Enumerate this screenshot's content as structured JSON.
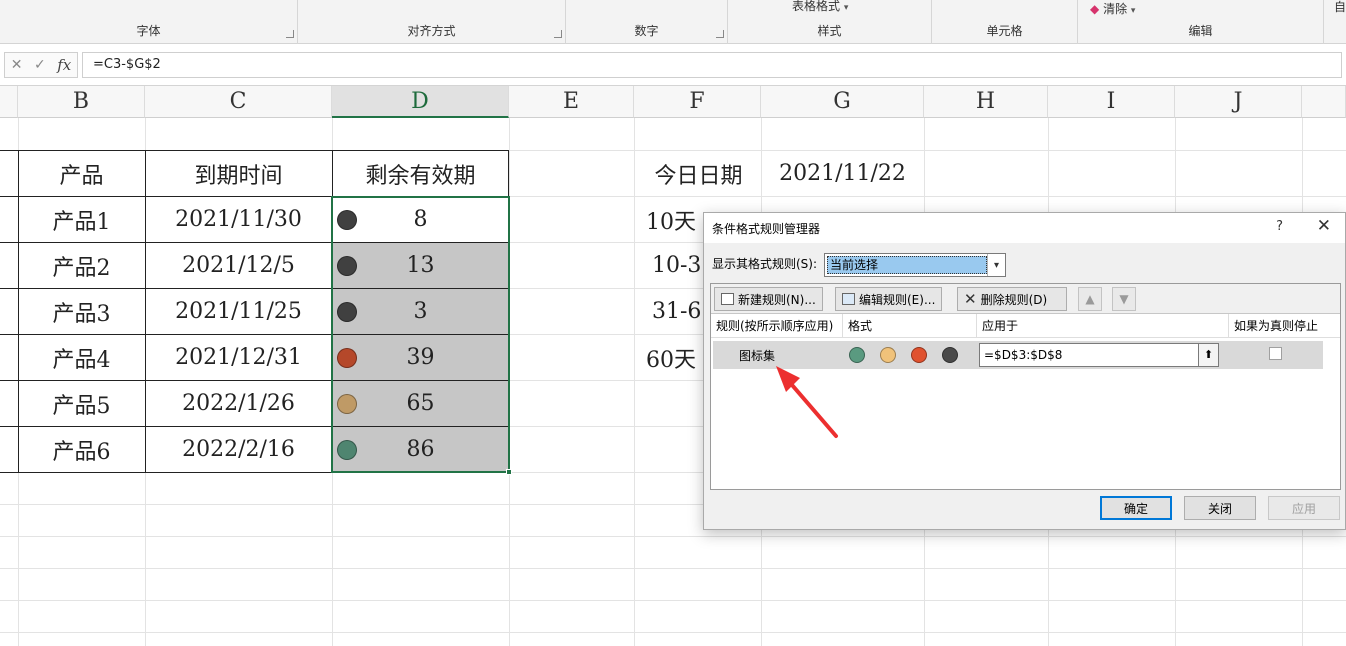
{
  "ribbon": {
    "groups": [
      {
        "label": "字体"
      },
      {
        "label": "对齐方式"
      },
      {
        "label": "数字"
      },
      {
        "label": "样式",
        "top_text": "表格格式"
      },
      {
        "label": "单元格"
      },
      {
        "label": "编辑",
        "top_text": "清除"
      }
    ],
    "edge_text": "自"
  },
  "formula_bar": {
    "cancel_glyph": "✕",
    "enter_glyph": "✓",
    "fx_label": "fx",
    "formula": "=C3-$G$2"
  },
  "columns": [
    "B",
    "C",
    "D",
    "E",
    "F",
    "G",
    "H",
    "I",
    "J"
  ],
  "sheet": {
    "headers": {
      "product": "产品",
      "due": "到期时间",
      "remain": "剩余有效期"
    },
    "rows": [
      {
        "product": "产品1",
        "due": "2021/11/30",
        "remain": "8",
        "icon_color": "#404040"
      },
      {
        "product": "产品2",
        "due": "2021/12/5",
        "remain": "13",
        "icon_color": "#404040"
      },
      {
        "product": "产品3",
        "due": "2021/11/25",
        "remain": "3",
        "icon_color": "#404040"
      },
      {
        "product": "产品4",
        "due": "2021/12/31",
        "remain": "39",
        "icon_color": "#b5482a"
      },
      {
        "product": "产品5",
        "due": "2022/1/26",
        "remain": "65",
        "icon_color": "#bf9a66"
      },
      {
        "product": "产品6",
        "due": "2022/2/16",
        "remain": "86",
        "icon_color": "#4f8570"
      }
    ],
    "today_label": "今日日期",
    "today_value": "2021/11/22",
    "f_labels": [
      "10天",
      "10-3",
      "31-6",
      "60天"
    ]
  },
  "dialog": {
    "title": "条件格式规则管理器",
    "help": "?",
    "close": "✕",
    "show_rules_label": "显示其格式规则(S):",
    "show_rules_value": "当前选择",
    "buttons": {
      "new_rule": "新建规则(N)...",
      "edit_rule": "编辑规则(E)...",
      "delete_rule": "删除规则(D)",
      "move_up": "▲",
      "move_down": "▼"
    },
    "columns": {
      "rule": "规则(按所示顺序应用)",
      "format": "格式",
      "applies_to": "应用于",
      "stop_if_true": "如果为真则停止"
    },
    "rule": {
      "name": "图标集",
      "icon_colors": [
        "#5a9a80",
        "#f0c27a",
        "#e0522f",
        "#4a4a4a"
      ],
      "applies_to": "=$D$3:$D$8",
      "picker_glyph": "⬆"
    },
    "footer": {
      "ok": "确定",
      "close": "关闭",
      "apply": "应用"
    }
  }
}
